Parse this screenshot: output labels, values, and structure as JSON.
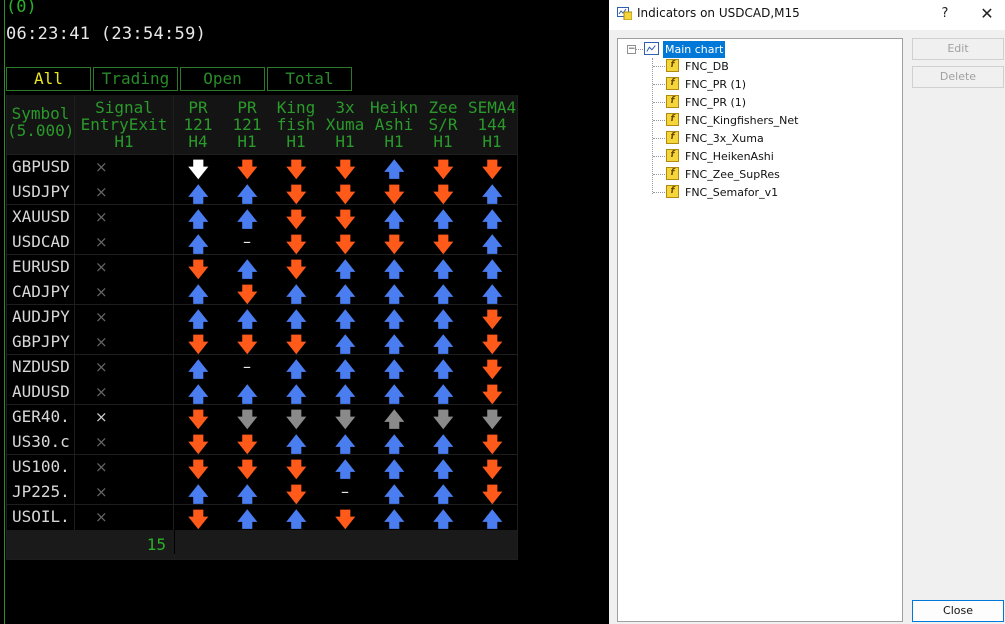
{
  "chart": {
    "top_value": "(0)",
    "clock": "06:23:41 (23:54:59)",
    "tabs": [
      "All",
      "Trading",
      "Open",
      "Total"
    ],
    "headers": {
      "symbol": "Symbol\n(5.000)",
      "signal": "Signal\nEntryExit\nH1",
      "cols": [
        "PR\n121\nH4",
        "PR\n121\nH1",
        "King\nfish\nH1",
        "3x\nXuma\nH1",
        "Heikn\nAshi\nH1",
        "Zee\nS/R\nH1",
        "SEMA4\n144\nH1"
      ]
    },
    "rows": [
      {
        "symbol": "GBPUSD",
        "signal": "×",
        "bright": false,
        "arrows": [
          "white-down",
          "down",
          "down",
          "down",
          "up",
          "down",
          "down"
        ]
      },
      {
        "symbol": "USDJPY",
        "signal": "×",
        "bright": false,
        "arrows": [
          "up",
          "up",
          "down",
          "down",
          "down",
          "down",
          "up"
        ]
      },
      {
        "symbol": "XAUUSD",
        "signal": "×",
        "bright": false,
        "arrows": [
          "up",
          "up",
          "down",
          "down",
          "up",
          "up",
          "up"
        ]
      },
      {
        "symbol": "USDCAD",
        "signal": "×",
        "bright": false,
        "arrows": [
          "up",
          "dash",
          "down",
          "down",
          "down",
          "down",
          "up"
        ]
      },
      {
        "symbol": "EURUSD",
        "signal": "×",
        "bright": false,
        "arrows": [
          "down",
          "up",
          "down",
          "up",
          "up",
          "up",
          "up"
        ]
      },
      {
        "symbol": "CADJPY",
        "signal": "×",
        "bright": false,
        "arrows": [
          "up",
          "down",
          "up",
          "up",
          "up",
          "up",
          "up"
        ]
      },
      {
        "symbol": "AUDJPY",
        "signal": "×",
        "bright": false,
        "arrows": [
          "up",
          "up",
          "up",
          "up",
          "up",
          "up",
          "down"
        ]
      },
      {
        "symbol": "GBPJPY",
        "signal": "×",
        "bright": false,
        "arrows": [
          "down",
          "down",
          "down",
          "up",
          "up",
          "up",
          "down"
        ]
      },
      {
        "symbol": "NZDUSD",
        "signal": "×",
        "bright": false,
        "arrows": [
          "up",
          "dash",
          "up",
          "up",
          "up",
          "up",
          "down"
        ]
      },
      {
        "symbol": "AUDUSD",
        "signal": "×",
        "bright": false,
        "arrows": [
          "up",
          "up",
          "up",
          "up",
          "up",
          "up",
          "down"
        ]
      },
      {
        "symbol": "GER40.",
        "signal": "×",
        "bright": true,
        "arrows": [
          "down",
          "gray-down",
          "gray-down",
          "gray-down",
          "gray-up",
          "gray-down",
          "gray-down"
        ]
      },
      {
        "symbol": "US30.c",
        "signal": "×",
        "bright": false,
        "arrows": [
          "down",
          "down",
          "up",
          "up",
          "up",
          "up",
          "down"
        ]
      },
      {
        "symbol": "US100.",
        "signal": "×",
        "bright": false,
        "arrows": [
          "down",
          "down",
          "down",
          "up",
          "up",
          "up",
          "down"
        ]
      },
      {
        "symbol": "JP225.",
        "signal": "×",
        "bright": false,
        "arrows": [
          "up",
          "up",
          "down",
          "dash",
          "up",
          "up",
          "down"
        ]
      },
      {
        "symbol": "USOIL.",
        "signal": "×",
        "bright": false,
        "arrows": [
          "down",
          "up",
          "up",
          "down",
          "up",
          "up",
          "up"
        ]
      }
    ],
    "glyphs": {
      "up": "🡅",
      "down": "🡇",
      "dash": "–"
    },
    "count": "15",
    "colors": {
      "up": "#4a7df0",
      "down": "#ff5a1a",
      "header": "#2a9a2a",
      "active_tab": "#e8e820"
    }
  },
  "dialog": {
    "title": "Indicators on USDCAD,M15",
    "help": "?",
    "close_x": "✕",
    "tree_root": "Main chart",
    "indicators": [
      "FNC_DB",
      "FNC_PR (1)",
      "FNC_PR (1)",
      "FNC_Kingfishers_Net",
      "FNC_3x_Xuma",
      "FNC_HeikenAshi",
      "FNC_Zee_SupRes",
      "FNC_Semafor_v1"
    ],
    "buttons": {
      "edit": "Edit",
      "delete": "Delete",
      "close": "Close"
    }
  }
}
